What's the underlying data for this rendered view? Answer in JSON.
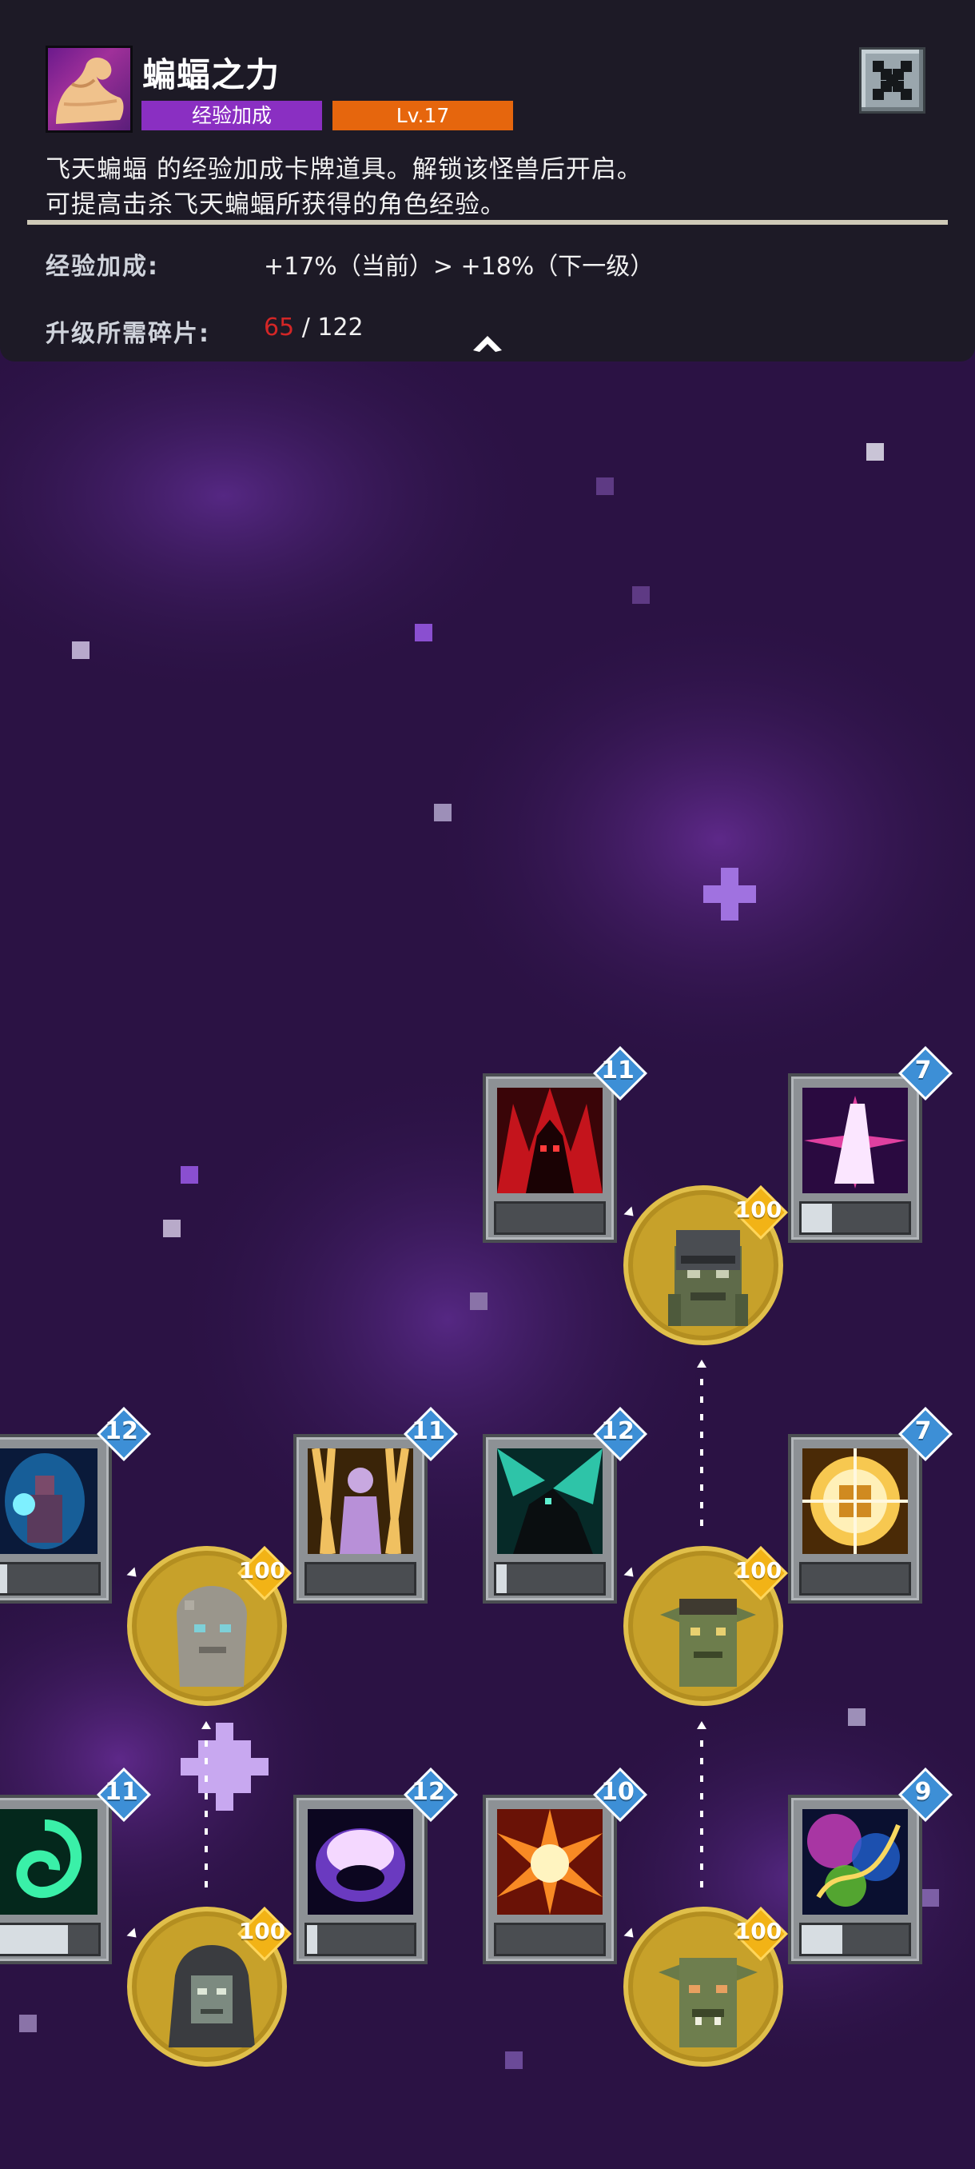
{
  "header": {
    "card_name": "蝙蝠之力",
    "card_type": "经验加成",
    "card_level": "Lv.17",
    "description_line1": "飞天蝙蝠 的经验加成卡牌道具。解锁该怪兽后开启。",
    "description_line2": "可提高击杀飞天蝙蝠所获得的角色经验。",
    "stat_label": "经验加成:",
    "stat_value": "+17%（当前）> +18%（下一级）",
    "fragments_label": "升级所需碎片:",
    "fragments_have": "65",
    "fragments_sep": " / ",
    "fragments_need": "122",
    "colors": {
      "type_tag": "#8a2fc2",
      "level_tag": "#e6660d",
      "fragments_have": "#d32626"
    },
    "icons": {
      "close": "close-icon",
      "collapse": "chevron-up-icon",
      "card": "flexed-arm-icon"
    }
  },
  "tree": {
    "cards": [
      {
        "name": "red-demon-skill",
        "level": "11",
        "progress": 0.0
      },
      {
        "name": "pink-star-skill",
        "level": "7",
        "progress": 0.28
      },
      {
        "name": "blue-mage-skill",
        "level": "12",
        "progress": 0.15
      },
      {
        "name": "golden-spirit-skill",
        "level": "11",
        "progress": 0.0
      },
      {
        "name": "teal-beast-skill",
        "level": "12",
        "progress": 0.1
      },
      {
        "name": "golden-rune-skill",
        "level": "7",
        "progress": 0.0
      },
      {
        "name": "green-swirl-skill",
        "level": "11",
        "progress": 0.72
      },
      {
        "name": "purple-orb-skill",
        "level": "12",
        "progress": 0.1
      },
      {
        "name": "fire-burst-skill",
        "level": "10",
        "progress": 0.0
      },
      {
        "name": "nebula-skill",
        "level": "9",
        "progress": 0.38
      }
    ],
    "monsters": [
      {
        "name": "armored-orc",
        "level": "100"
      },
      {
        "name": "stone-golem",
        "level": "100"
      },
      {
        "name": "goblin",
        "level": "100"
      },
      {
        "name": "hooded-ghoul",
        "level": "100"
      },
      {
        "name": "goblin-chief",
        "level": "100"
      }
    ]
  }
}
